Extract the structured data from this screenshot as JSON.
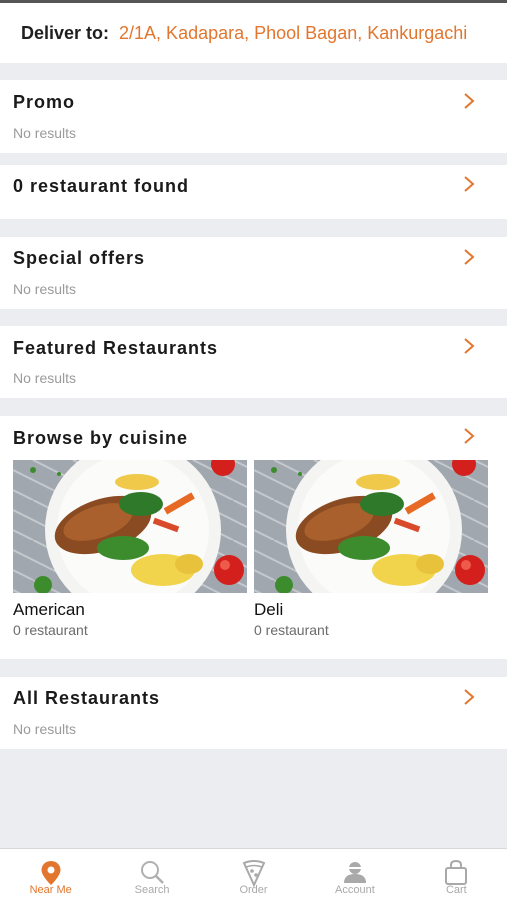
{
  "header": {
    "deliver_label": "Deliver to:",
    "address": "2/1A, Kadapara, Phool Bagan, Kankurgachi"
  },
  "sections": [
    {
      "title": "Promo",
      "subtitle": "No results"
    },
    {
      "title": "0 restaurant found",
      "subtitle": ""
    },
    {
      "title": "Special offers",
      "subtitle": "No results"
    },
    {
      "title": "Featured Restaurants",
      "subtitle": "No results"
    },
    {
      "title": "Browse by cuisine",
      "subtitle": ""
    },
    {
      "title": "All Restaurants",
      "subtitle": "No results"
    }
  ],
  "cuisines": [
    {
      "name": "American",
      "count": "0 restaurant"
    },
    {
      "name": "Deli",
      "count": "0 restaurant"
    }
  ],
  "tabbar": {
    "items": [
      {
        "label": "Near Me",
        "icon": "location-pin-icon",
        "active": true
      },
      {
        "label": "Search",
        "icon": "search-icon",
        "active": false
      },
      {
        "label": "Order",
        "icon": "pizza-slice-icon",
        "active": false
      },
      {
        "label": "Account",
        "icon": "user-icon",
        "active": false
      },
      {
        "label": "Cart",
        "icon": "shopping-bag-icon",
        "active": false
      }
    ]
  },
  "colors": {
    "accent": "#e2762e",
    "background": "#ecedf0",
    "muted": "#9a9a9a"
  }
}
